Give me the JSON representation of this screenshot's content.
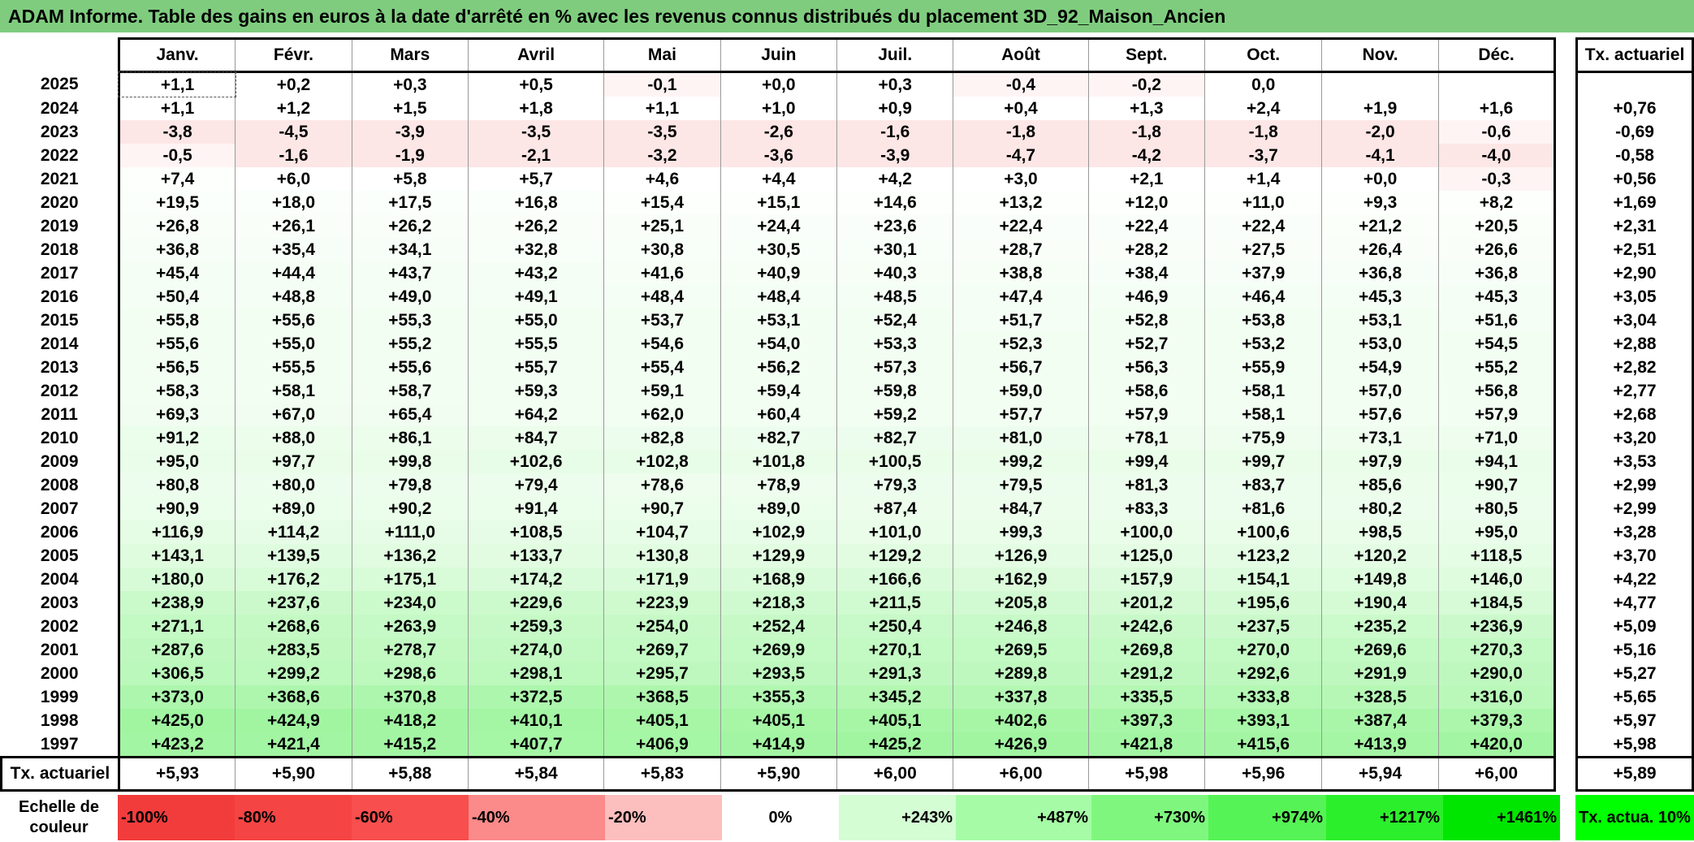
{
  "title": "ADAM Informe. Table des gains en euros à la date d'arrêté en % avec les revenus connus distribués du placement 3D_92_Maison_Ancien",
  "months": [
    "Janv.",
    "Févr.",
    "Mars",
    "Avril",
    "Mai",
    "Juin",
    "Juil.",
    "Août",
    "Sept.",
    "Oct.",
    "Nov.",
    "Déc."
  ],
  "rate_header": "Tx. actuariel",
  "rows": [
    {
      "year": "2025",
      "values": [
        "+1,1",
        "+0,2",
        "+0,3",
        "+0,5",
        "-0,1",
        "+0,0",
        "+0,3",
        "-0,4",
        "-0,2",
        "0,0",
        "",
        ""
      ],
      "rate": ""
    },
    {
      "year": "2024",
      "values": [
        "+1,1",
        "+1,2",
        "+1,5",
        "+1,8",
        "+1,1",
        "+1,0",
        "+0,9",
        "+0,4",
        "+1,3",
        "+2,4",
        "+1,9",
        "+1,6"
      ],
      "rate": "+0,76"
    },
    {
      "year": "2023",
      "values": [
        "-3,8",
        "-4,5",
        "-3,9",
        "-3,5",
        "-3,5",
        "-2,6",
        "-1,6",
        "-1,8",
        "-1,8",
        "-1,8",
        "-2,0",
        "-0,6"
      ],
      "rate": "-0,69"
    },
    {
      "year": "2022",
      "values": [
        "-0,5",
        "-1,6",
        "-1,9",
        "-2,1",
        "-3,2",
        "-3,6",
        "-3,9",
        "-4,7",
        "-4,2",
        "-3,7",
        "-4,1",
        "-4,0"
      ],
      "rate": "-0,58"
    },
    {
      "year": "2021",
      "values": [
        "+7,4",
        "+6,0",
        "+5,8",
        "+5,7",
        "+4,6",
        "+4,4",
        "+4,2",
        "+3,0",
        "+2,1",
        "+1,4",
        "+0,0",
        "-0,3"
      ],
      "rate": "+0,56"
    },
    {
      "year": "2020",
      "values": [
        "+19,5",
        "+18,0",
        "+17,5",
        "+16,8",
        "+15,4",
        "+15,1",
        "+14,6",
        "+13,2",
        "+12,0",
        "+11,0",
        "+9,3",
        "+8,2"
      ],
      "rate": "+1,69"
    },
    {
      "year": "2019",
      "values": [
        "+26,8",
        "+26,1",
        "+26,2",
        "+26,2",
        "+25,1",
        "+24,4",
        "+23,6",
        "+22,4",
        "+22,4",
        "+22,4",
        "+21,2",
        "+20,5"
      ],
      "rate": "+2,31"
    },
    {
      "year": "2018",
      "values": [
        "+36,8",
        "+35,4",
        "+34,1",
        "+32,8",
        "+30,8",
        "+30,5",
        "+30,1",
        "+28,7",
        "+28,2",
        "+27,5",
        "+26,4",
        "+26,6"
      ],
      "rate": "+2,51"
    },
    {
      "year": "2017",
      "values": [
        "+45,4",
        "+44,4",
        "+43,7",
        "+43,2",
        "+41,6",
        "+40,9",
        "+40,3",
        "+38,8",
        "+38,4",
        "+37,9",
        "+36,8",
        "+36,8"
      ],
      "rate": "+2,90"
    },
    {
      "year": "2016",
      "values": [
        "+50,4",
        "+48,8",
        "+49,0",
        "+49,1",
        "+48,4",
        "+48,4",
        "+48,5",
        "+47,4",
        "+46,9",
        "+46,4",
        "+45,3",
        "+45,3"
      ],
      "rate": "+3,05"
    },
    {
      "year": "2015",
      "values": [
        "+55,8",
        "+55,6",
        "+55,3",
        "+55,0",
        "+53,7",
        "+53,1",
        "+52,4",
        "+51,7",
        "+52,8",
        "+53,8",
        "+53,1",
        "+51,6"
      ],
      "rate": "+3,04"
    },
    {
      "year": "2014",
      "values": [
        "+55,6",
        "+55,0",
        "+55,2",
        "+55,5",
        "+54,6",
        "+54,0",
        "+53,3",
        "+52,3",
        "+52,7",
        "+53,2",
        "+53,0",
        "+54,5"
      ],
      "rate": "+2,88"
    },
    {
      "year": "2013",
      "values": [
        "+56,5",
        "+55,5",
        "+55,6",
        "+55,7",
        "+55,4",
        "+56,2",
        "+57,3",
        "+56,7",
        "+56,3",
        "+55,9",
        "+54,9",
        "+55,2"
      ],
      "rate": "+2,82"
    },
    {
      "year": "2012",
      "values": [
        "+58,3",
        "+58,1",
        "+58,7",
        "+59,3",
        "+59,1",
        "+59,4",
        "+59,8",
        "+59,0",
        "+58,6",
        "+58,1",
        "+57,0",
        "+56,8"
      ],
      "rate": "+2,77"
    },
    {
      "year": "2011",
      "values": [
        "+69,3",
        "+67,0",
        "+65,4",
        "+64,2",
        "+62,0",
        "+60,4",
        "+59,2",
        "+57,7",
        "+57,9",
        "+58,1",
        "+57,6",
        "+57,9"
      ],
      "rate": "+2,68"
    },
    {
      "year": "2010",
      "values": [
        "+91,2",
        "+88,0",
        "+86,1",
        "+84,7",
        "+82,8",
        "+82,7",
        "+82,7",
        "+81,0",
        "+78,1",
        "+75,9",
        "+73,1",
        "+71,0"
      ],
      "rate": "+3,20"
    },
    {
      "year": "2009",
      "values": [
        "+95,0",
        "+97,7",
        "+99,8",
        "+102,6",
        "+102,8",
        "+101,8",
        "+100,5",
        "+99,2",
        "+99,4",
        "+99,7",
        "+97,9",
        "+94,1"
      ],
      "rate": "+3,53"
    },
    {
      "year": "2008",
      "values": [
        "+80,8",
        "+80,0",
        "+79,8",
        "+79,4",
        "+78,6",
        "+78,9",
        "+79,3",
        "+79,5",
        "+81,3",
        "+83,7",
        "+85,6",
        "+90,7"
      ],
      "rate": "+2,99"
    },
    {
      "year": "2007",
      "values": [
        "+90,9",
        "+89,0",
        "+90,2",
        "+91,4",
        "+90,7",
        "+89,0",
        "+87,4",
        "+84,7",
        "+83,3",
        "+81,6",
        "+80,2",
        "+80,5"
      ],
      "rate": "+2,99"
    },
    {
      "year": "2006",
      "values": [
        "+116,9",
        "+114,2",
        "+111,0",
        "+108,5",
        "+104,7",
        "+102,9",
        "+101,0",
        "+99,3",
        "+100,0",
        "+100,6",
        "+98,5",
        "+95,0"
      ],
      "rate": "+3,28"
    },
    {
      "year": "2005",
      "values": [
        "+143,1",
        "+139,5",
        "+136,2",
        "+133,7",
        "+130,8",
        "+129,9",
        "+129,2",
        "+126,9",
        "+125,0",
        "+123,2",
        "+120,2",
        "+118,5"
      ],
      "rate": "+3,70"
    },
    {
      "year": "2004",
      "values": [
        "+180,0",
        "+176,2",
        "+175,1",
        "+174,2",
        "+171,9",
        "+168,9",
        "+166,6",
        "+162,9",
        "+157,9",
        "+154,1",
        "+149,8",
        "+146,0"
      ],
      "rate": "+4,22"
    },
    {
      "year": "2003",
      "values": [
        "+238,9",
        "+237,6",
        "+234,0",
        "+229,6",
        "+223,9",
        "+218,3",
        "+211,5",
        "+205,8",
        "+201,2",
        "+195,6",
        "+190,4",
        "+184,5"
      ],
      "rate": "+4,77"
    },
    {
      "year": "2002",
      "values": [
        "+271,1",
        "+268,6",
        "+263,9",
        "+259,3",
        "+254,0",
        "+252,4",
        "+250,4",
        "+246,8",
        "+242,6",
        "+237,5",
        "+235,2",
        "+236,9"
      ],
      "rate": "+5,09"
    },
    {
      "year": "2001",
      "values": [
        "+287,6",
        "+283,5",
        "+278,7",
        "+274,0",
        "+269,7",
        "+269,9",
        "+270,1",
        "+269,5",
        "+269,8",
        "+270,0",
        "+269,6",
        "+270,3"
      ],
      "rate": "+5,16"
    },
    {
      "year": "2000",
      "values": [
        "+306,5",
        "+299,2",
        "+298,6",
        "+298,1",
        "+295,7",
        "+293,5",
        "+291,3",
        "+289,8",
        "+291,2",
        "+292,6",
        "+291,9",
        "+290,0"
      ],
      "rate": "+5,27"
    },
    {
      "year": "1999",
      "values": [
        "+373,0",
        "+368,6",
        "+370,8",
        "+372,5",
        "+368,5",
        "+355,3",
        "+345,2",
        "+337,8",
        "+335,5",
        "+333,8",
        "+328,5",
        "+316,0"
      ],
      "rate": "+5,65"
    },
    {
      "year": "1998",
      "values": [
        "+425,0",
        "+424,9",
        "+418,2",
        "+410,1",
        "+405,1",
        "+405,1",
        "+405,1",
        "+402,6",
        "+397,3",
        "+393,1",
        "+387,4",
        "+379,3"
      ],
      "rate": "+5,97"
    },
    {
      "year": "1997",
      "values": [
        "+423,2",
        "+421,4",
        "+415,2",
        "+407,7",
        "+406,9",
        "+414,9",
        "+425,2",
        "+426,9",
        "+421,8",
        "+415,6",
        "+413,9",
        "+420,0"
      ],
      "rate": "+5,98"
    }
  ],
  "totals": {
    "label": "Tx. actuariel",
    "values": [
      "+5,93",
      "+5,90",
      "+5,88",
      "+5,84",
      "+5,83",
      "+5,90",
      "+6,00",
      "+6,00",
      "+5,98",
      "+5,96",
      "+5,94",
      "+6,00"
    ],
    "rate": "+5,89"
  },
  "legend": {
    "label": "Echelle de couleur",
    "cells": [
      {
        "text": "-100%",
        "color": "#f23c3c",
        "align": "left"
      },
      {
        "text": "-80%",
        "color": "#f54444",
        "align": "left"
      },
      {
        "text": "-60%",
        "color": "#f84e4e",
        "align": "left"
      },
      {
        "text": "-40%",
        "color": "#fb8a8a",
        "align": "left"
      },
      {
        "text": "-20%",
        "color": "#fdbebe",
        "align": "left"
      },
      {
        "text": "0%",
        "color": "#ffffff",
        "align": "center"
      },
      {
        "text": "+243%",
        "color": "#d4fdd4",
        "align": "right"
      },
      {
        "text": "+487%",
        "color": "#a6fba6",
        "align": "right"
      },
      {
        "text": "+730%",
        "color": "#7ff77f",
        "align": "right"
      },
      {
        "text": "+974%",
        "color": "#55f355",
        "align": "right"
      },
      {
        "text": "+1217%",
        "color": "#2bef2b",
        "align": "right"
      },
      {
        "text": "+1461%",
        "color": "#00e600",
        "align": "right"
      }
    ],
    "tx_label": "Tx. actua. 10%",
    "tx_color": "#00ff00"
  },
  "colors": {
    "title_bg": "#7fcc7f",
    "negative_row_bg": "#fde6e6",
    "positive_max": "#a4f5a4"
  }
}
